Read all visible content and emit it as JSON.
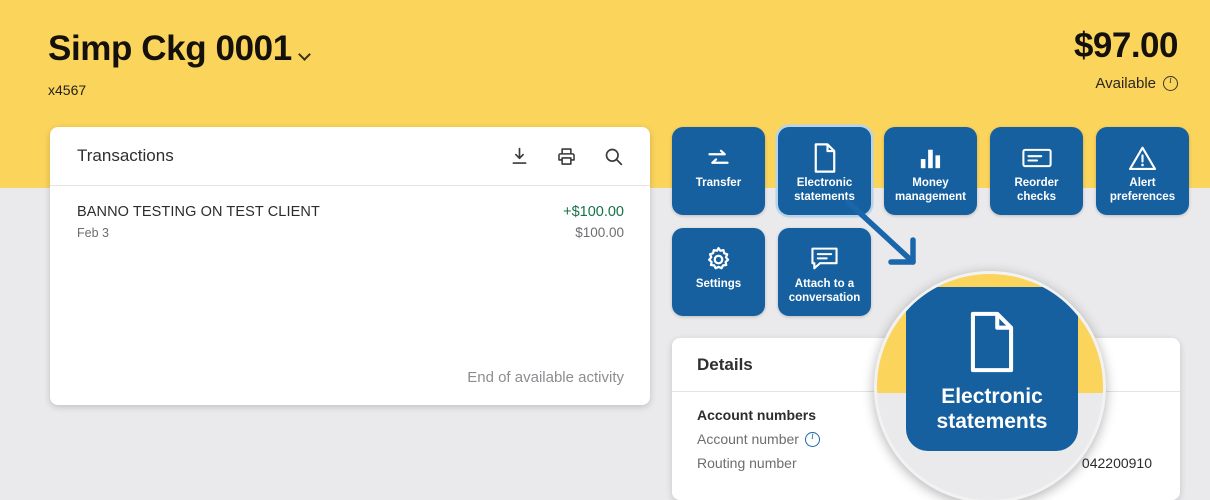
{
  "header": {
    "account_name": "Simp Ckg 0001",
    "account_mask": "x4567",
    "balance": "$97.00",
    "balance_label": "Available",
    "chevron_icon": "chevron-down-icon",
    "info_icon": "info-icon",
    "background_color": "#fbd45c"
  },
  "transactions": {
    "title": "Transactions",
    "icons": [
      {
        "name": "download-icon"
      },
      {
        "name": "print-icon"
      },
      {
        "name": "search-icon"
      }
    ],
    "rows": [
      {
        "description": "BANNO TESTING ON TEST CLIENT",
        "date": "Feb 3",
        "amount": "+$100.00",
        "balance": "$100.00",
        "amount_color": "#157347"
      }
    ],
    "footer": "End of available activity"
  },
  "quick_actions": {
    "rows": [
      [
        {
          "label": "Transfer",
          "icon": "transfer-arrows-icon",
          "focused": false
        },
        {
          "label": "Electronic statements",
          "icon": "document-icon",
          "focused": true
        },
        {
          "label": "Money management",
          "icon": "bar-chart-icon",
          "focused": false
        },
        {
          "label": "Reorder checks",
          "icon": "check-card-icon",
          "focused": false
        },
        {
          "label": "Alert preferences",
          "icon": "warning-triangle-icon",
          "focused": false
        }
      ],
      [
        {
          "label": "Settings",
          "icon": "gear-icon",
          "focused": false
        },
        {
          "label": "Attach to a conversation",
          "icon": "chat-bubble-icon",
          "focused": false
        }
      ]
    ],
    "tile_color": "#16609f"
  },
  "details": {
    "title": "Details",
    "section_label": "Account numbers",
    "rows": [
      {
        "label": "Account number",
        "value": "",
        "info_icon": "info-icon"
      },
      {
        "label": "Routing number",
        "value": "042200910",
        "info_icon": ""
      }
    ]
  },
  "callout": {
    "arrow_icon": "arrow-down-right-icon",
    "arrow_color": "#1a66ab",
    "magnified_label": "Electronic statements",
    "magnified_icon": "document-icon"
  }
}
